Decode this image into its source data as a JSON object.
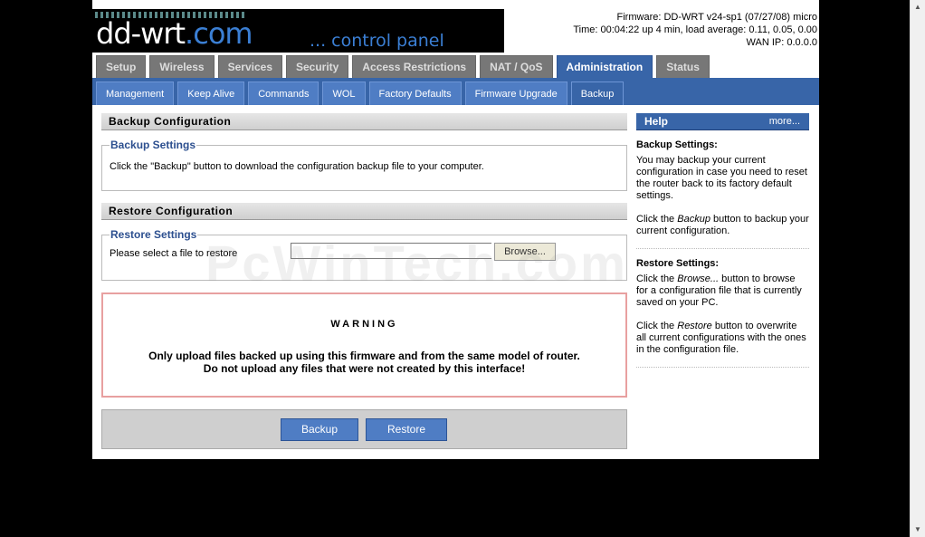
{
  "logo": {
    "brand": "dd-wrt",
    "brand_suffix": ".com",
    "tagline": "... control panel"
  },
  "info": {
    "firmware": "Firmware: DD-WRT v24-sp1 (07/27/08) micro",
    "time": "Time: 00:04:22 up 4 min, load average: 0.11, 0.05, 0.00",
    "wan_ip": "WAN IP: 0.0.0.0"
  },
  "tabs": [
    {
      "label": "Setup"
    },
    {
      "label": "Wireless"
    },
    {
      "label": "Services"
    },
    {
      "label": "Security"
    },
    {
      "label": "Access Restrictions"
    },
    {
      "label": "NAT / QoS"
    },
    {
      "label": "Administration",
      "active": true
    },
    {
      "label": "Status"
    }
  ],
  "subtabs": [
    {
      "label": "Management"
    },
    {
      "label": "Keep Alive"
    },
    {
      "label": "Commands"
    },
    {
      "label": "WOL"
    },
    {
      "label": "Factory Defaults"
    },
    {
      "label": "Firmware Upgrade"
    },
    {
      "label": "Backup",
      "active": true
    }
  ],
  "backup": {
    "title": "Backup Configuration",
    "legend": "Backup Settings",
    "text": "Click the \"Backup\" button to download the configuration backup file to your computer."
  },
  "restore": {
    "title": "Restore Configuration",
    "legend": "Restore Settings",
    "label": "Please select a file to restore",
    "browse": "Browse..."
  },
  "warning": {
    "title": "WARNING",
    "line1": "Only upload files backed up using this firmware and from the same model of router.",
    "line2": "Do not upload any files that were not created by this interface!"
  },
  "buttons": {
    "backup": "Backup",
    "restore": "Restore"
  },
  "help": {
    "title": "Help",
    "more": "more...",
    "backup_heading": "Backup Settings:",
    "backup_p1": "You may backup your current configuration in case you need to reset the router back to its factory default settings.",
    "backup_p2_pre": "Click the ",
    "backup_p2_em": "Backup",
    "backup_p2_post": " button to backup your current configuration.",
    "restore_heading": "Restore Settings:",
    "restore_p1_pre": "Click the ",
    "restore_p1_em": "Browse...",
    "restore_p1_post": " button to browse for a configuration file that is currently saved on your PC.",
    "restore_p2_pre": "Click the ",
    "restore_p2_em": "Restore",
    "restore_p2_post": " button to overwrite all current configurations with the ones in the configuration file."
  },
  "watermark": "PcWinTech.com",
  "colors": {
    "accent": "#3865a8",
    "tab_inactive": "#777777",
    "legend": "#2c4f8f",
    "warning_border": "#e8a0a0"
  }
}
